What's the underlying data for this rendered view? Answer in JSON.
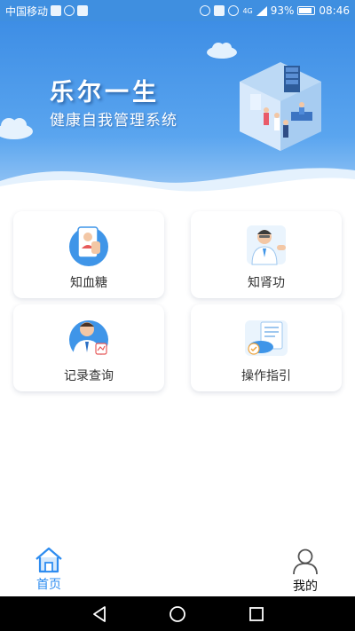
{
  "status_bar": {
    "carrier": "中国移动",
    "network": "4G",
    "battery": "93%",
    "time": "08:46"
  },
  "hero": {
    "title": "乐尔一生",
    "subtitle": "健康自我管理系统"
  },
  "cards": [
    {
      "label": "知血糖",
      "icon": "blood-sugar-icon"
    },
    {
      "label": "知肾功",
      "icon": "doctor-icon"
    },
    {
      "label": "记录查询",
      "icon": "record-icon"
    },
    {
      "label": "操作指引",
      "icon": "guide-icon"
    }
  ],
  "tabs": [
    {
      "label": "首页",
      "icon": "home-icon",
      "active": true
    },
    {
      "label": "我的",
      "icon": "user-icon",
      "active": false
    }
  ],
  "colors": {
    "primary": "#3e8ee5",
    "active_tab": "#2d8cf0",
    "text": "#333333"
  }
}
